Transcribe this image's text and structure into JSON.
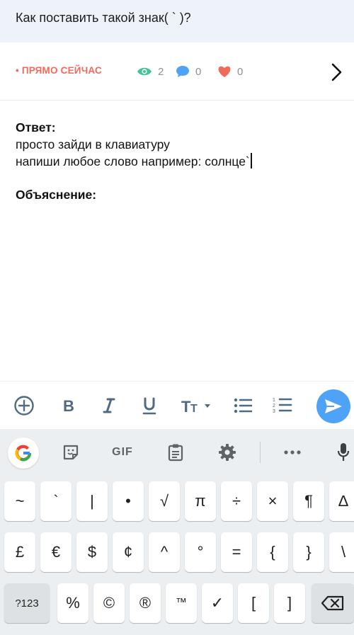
{
  "question": {
    "text": "Как поставить такой знак( ` )?"
  },
  "meta": {
    "live_label": "• ПРЯМО СЕЙЧАС",
    "views": "2",
    "comments": "0",
    "likes": "0"
  },
  "answer": {
    "heading": "Ответ:",
    "line1": "просто зайди в клавиатуру",
    "line2": "напиши любое слово например: солнце`",
    "explanation_heading": "Объяснение:"
  },
  "toolbar": {
    "items": [
      "add-icon",
      "bold-icon",
      "italic-icon",
      "underline-icon",
      "text-size-icon",
      "bullet-list-icon",
      "numbered-list-icon",
      "send-icon"
    ]
  },
  "keyboard_top": {
    "gif_label": "GIF"
  },
  "keyboard": {
    "row1": [
      "~",
      "`",
      "|",
      "•",
      "√",
      "π",
      "÷",
      "×",
      "¶",
      "∆"
    ],
    "row2": [
      "£",
      "€",
      "$",
      "¢",
      "^",
      "°",
      "=",
      "{",
      "}",
      "\\"
    ],
    "row3": [
      "?123",
      "%",
      "©",
      "®",
      "™",
      "✓",
      "[",
      "]"
    ]
  },
  "colors": {
    "accent_live": "#f06a5b",
    "send_button": "#4fa3f7",
    "views_icon": "#47c19a",
    "comments_icon": "#4fa3f7",
    "likes_icon": "#f06a5b",
    "question_bg": "#eef2f9",
    "keyboard_bg": "#eceff1"
  }
}
